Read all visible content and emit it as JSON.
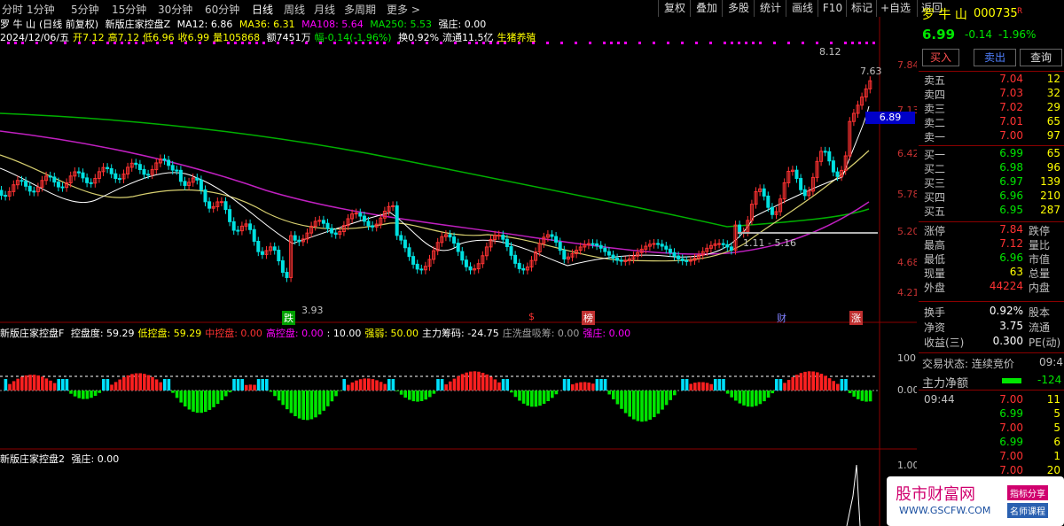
{
  "toolbar": {
    "periods": [
      "分时",
      "1分钟",
      "5分钟",
      "15分钟",
      "30分钟",
      "60分钟",
      "日线",
      "周线",
      "月线",
      "多周期",
      "更多 >"
    ],
    "active_period": "日线",
    "buttons": [
      "复权",
      "叠加",
      "多股",
      "统计",
      "画线",
      "F10",
      "标记",
      "+自选",
      "返回"
    ]
  },
  "chart_header": {
    "line1": {
      "stock": "罗 牛 山",
      "mode": "(日线 前复权)",
      "indicator": "新版庄家控盘Z",
      "ma12": "MA12: 6.86",
      "ma36": "MA36: 6.31",
      "ma108": "MA108: 5.64",
      "ma250": "MA250: 5.53",
      "strong": "强庄: 0.00"
    },
    "line2": {
      "date": "2024/12/06/五",
      "open": "开7.12",
      "high": "高7.12",
      "low": "低6.96",
      "close": "收6.99",
      "volume": "量105868",
      "amount": "额7451万",
      "change": "幅-0.14(-1.96%)",
      "turnover": "换0.92%",
      "float": "流通11.5亿",
      "concept": "生猪养殖"
    }
  },
  "price_axis": {
    "labels": [
      "7.84",
      "7.13",
      "6.42",
      "5.78",
      "5.20",
      "4.68",
      "4.21"
    ],
    "current": "6.89"
  },
  "annotations": {
    "high_label": "8.12",
    "high2_label": "7.63",
    "low_label": "3.93",
    "range_label": "1.11 - 5.16",
    "strong_label": "强",
    "markers": [
      "跌",
      "$",
      "榜",
      "财",
      "涨"
    ]
  },
  "panel2": {
    "title": "新版庄家控盘F",
    "items": [
      {
        "label": "控盘度: 59.29",
        "color": "#ffffff"
      },
      {
        "label": "低控盘: 59.29",
        "color": "#ffff00"
      },
      {
        "label": "中控盘: 0.00",
        "color": "#ff3232"
      },
      {
        "label": "高控盘: 0.00",
        "color": "#ff00ff"
      },
      {
        "label": ": 10.00",
        "color": "#ffffff"
      },
      {
        "label": "强弱: 50.00",
        "color": "#ffff00"
      },
      {
        "label": "主力筹码: -24.75",
        "color": "#ffffff"
      },
      {
        "label": "庄洗盘吸筹: 0.00",
        "color": "#a0a0a0"
      },
      {
        "label": "强庄: 0.00",
        "color": "#ff00ff"
      }
    ],
    "axis": [
      "100.0",
      "0.00"
    ]
  },
  "panel3": {
    "title": "新版庄家控盘2",
    "strong": "强庄: 0.00",
    "axis": [
      "1.00"
    ]
  },
  "quote": {
    "name": "罗 牛 山",
    "code": "000735",
    "badge": "R",
    "price": "6.99",
    "change": "-0.14",
    "pct": "-1.96%",
    "buy_btn": "买入",
    "sell_btn": "卖出",
    "query_btn": "查询",
    "asks": [
      {
        "k": "卖五",
        "p": "7.04",
        "v": "12"
      },
      {
        "k": "卖四",
        "p": "7.03",
        "v": "32"
      },
      {
        "k": "卖三",
        "p": "7.02",
        "v": "29"
      },
      {
        "k": "卖二",
        "p": "7.01",
        "v": "65"
      },
      {
        "k": "卖一",
        "p": "7.00",
        "v": "97"
      }
    ],
    "bids": [
      {
        "k": "买一",
        "p": "6.99",
        "v": "65"
      },
      {
        "k": "买二",
        "p": "6.98",
        "v": "96"
      },
      {
        "k": "买三",
        "p": "6.97",
        "v": "139"
      },
      {
        "k": "买四",
        "p": "6.96",
        "v": "210"
      },
      {
        "k": "买五",
        "p": "6.95",
        "v": "287"
      }
    ],
    "stats": [
      {
        "k": "涨停",
        "v": "7.84",
        "c": "red",
        "k2": "跌停"
      },
      {
        "k": "最高",
        "v": "7.12",
        "c": "red",
        "k2": "量比"
      },
      {
        "k": "最低",
        "v": "6.96",
        "c": "green",
        "k2": "市值"
      },
      {
        "k": "现量",
        "v": "63",
        "c": "yellow",
        "k2": "总量"
      },
      {
        "k": "外盘",
        "v": "44224",
        "c": "red",
        "k2": "内盘"
      }
    ],
    "stats2": [
      {
        "k": "换手",
        "v": "0.92%",
        "k2": "股本"
      },
      {
        "k": "净资",
        "v": "3.75",
        "k2": "流通"
      },
      {
        "k": "收益(三)",
        "v": "0.300",
        "k2": "PE(动)"
      }
    ],
    "trade_status": "交易状态: 连续竞价",
    "trade_time": "09:4",
    "net_label": "主力净额",
    "net_value": "-124",
    "ticks": [
      {
        "t": "09:44",
        "p": "7.00",
        "v": "11",
        "pc": "red"
      },
      {
        "t": "",
        "p": "6.99",
        "v": "5",
        "pc": "green"
      },
      {
        "t": "",
        "p": "7.00",
        "v": "5",
        "pc": "red"
      },
      {
        "t": "",
        "p": "6.99",
        "v": "6",
        "pc": "green"
      },
      {
        "t": "",
        "p": "7.00",
        "v": "1",
        "pc": "red"
      },
      {
        "t": "",
        "p": "7.00",
        "v": "20",
        "pc": "red"
      }
    ]
  },
  "watermark": {
    "title": "股市财富网",
    "url": "WWW.GSCFW.COM",
    "tag1": "指标分享",
    "tag2": "名师课程"
  }
}
